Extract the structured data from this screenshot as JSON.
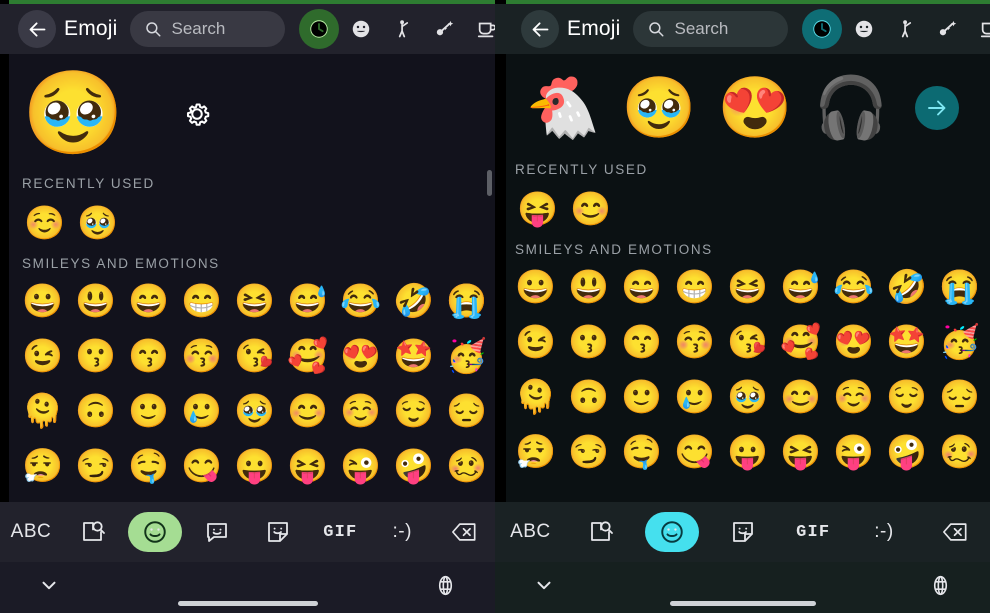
{
  "theme": {
    "left_accent": "#a5dd93",
    "right_accent": "#45e0ee",
    "left_bg": "#12121c",
    "right_bg": "#0b1113",
    "left_header_bg": "#22222c",
    "right_header_bg": "#1a2224",
    "left_active_cat": "#2f6b2c",
    "right_active_cat": "#0e6d75",
    "section_label_color": "#9aa0a6"
  },
  "left_panel": {
    "header": {
      "back_icon": "arrow-left-icon",
      "title": "Emoji",
      "search": {
        "icon": "search-icon",
        "placeholder": "Search",
        "value": ""
      },
      "categories": [
        {
          "name": "recent",
          "icon": "clock-icon",
          "active": true
        },
        {
          "name": "smileys",
          "icon": "smiley-icon",
          "active": false
        },
        {
          "name": "people",
          "icon": "person-icon",
          "active": false
        },
        {
          "name": "animals-nature",
          "icon": "leaf-flower-icon",
          "active": false
        },
        {
          "name": "food-drink",
          "icon": "cup-icon",
          "active": false
        }
      ]
    },
    "featured": {
      "emoji": "🥹",
      "settings_icon": "gear-icon"
    },
    "sections": [
      {
        "label": "RECENTLY USED",
        "emojis": [
          "☺️",
          "🥹"
        ]
      },
      {
        "label": "SMILEYS AND EMOTIONS",
        "rows": [
          [
            "😀",
            "😃",
            "😄",
            "😁",
            "😆",
            "😅",
            "😂",
            "🤣",
            "😭"
          ],
          [
            "😉",
            "😗",
            "😙",
            "😚",
            "😘",
            "🥰",
            "😍",
            "🤩",
            "🥳"
          ],
          [
            "🫠",
            "🙃",
            "🙂",
            "🥲",
            "🥹",
            "😊",
            "☺️",
            "😌",
            "😔"
          ],
          [
            "😮‍💨",
            "😏",
            "🤤",
            "😋",
            "😛",
            "😝",
            "😜",
            "🤪",
            "🥴"
          ]
        ]
      }
    ],
    "toolbar": [
      {
        "name": "abc-key",
        "label": "ABC",
        "type": "text",
        "active": false
      },
      {
        "name": "image-search-button",
        "label": "image-search-icon",
        "type": "icon",
        "active": false
      },
      {
        "name": "emoji-tab-button",
        "label": "smiley-icon",
        "type": "icon",
        "active": true
      },
      {
        "name": "emotion-sticker-button",
        "label": "speech-sticker-icon",
        "type": "icon",
        "active": false
      },
      {
        "name": "sticker-button",
        "label": "sticker-icon",
        "type": "icon",
        "active": false
      },
      {
        "name": "gif-button",
        "label": "GIF",
        "type": "text-gif",
        "active": false
      },
      {
        "name": "kaomoji-button",
        "label": ":-)",
        "type": "text-kao",
        "active": false
      },
      {
        "name": "backspace-button",
        "label": "backspace-icon",
        "type": "icon",
        "active": false
      }
    ],
    "navbar": {
      "back_icon": "chevron-down-icon",
      "language_icon": "globe-icon",
      "home_indicator": "home-indicator"
    }
  },
  "right_panel": {
    "header": {
      "back_icon": "arrow-left-icon",
      "title": "Emoji",
      "search": {
        "icon": "search-icon",
        "placeholder": "Search",
        "value": ""
      },
      "categories": [
        {
          "name": "recent",
          "icon": "clock-icon",
          "active": true
        },
        {
          "name": "smileys",
          "icon": "smiley-icon",
          "active": false
        },
        {
          "name": "people",
          "icon": "person-icon",
          "active": false
        },
        {
          "name": "animals-nature",
          "icon": "leaf-flower-icon",
          "active": false
        },
        {
          "name": "food-drink",
          "icon": "cup-icon",
          "active": false
        }
      ]
    },
    "featured": {
      "suggestions": [
        "🐔",
        "🥹",
        "😍",
        "🎧"
      ],
      "more_icon": "arrow-right-icon"
    },
    "sections": [
      {
        "label": "RECENTLY USED",
        "emojis": [
          "😝",
          "😊"
        ]
      },
      {
        "label": "SMILEYS AND EMOTIONS",
        "rows": [
          [
            "😀",
            "😃",
            "😄",
            "😁",
            "😆",
            "😅",
            "😂",
            "🤣",
            "😭"
          ],
          [
            "😉",
            "😗",
            "😙",
            "😚",
            "😘",
            "🥰",
            "😍",
            "🤩",
            "🥳"
          ],
          [
            "🫠",
            "🙃",
            "🙂",
            "🥲",
            "🥹",
            "😊",
            "☺️",
            "😌",
            "😔"
          ],
          [
            "😮‍💨",
            "😏",
            "🤤",
            "😋",
            "😛",
            "😝",
            "😜",
            "🤪",
            "🥴"
          ]
        ]
      }
    ],
    "toolbar": [
      {
        "name": "abc-key",
        "label": "ABC",
        "type": "text",
        "active": false
      },
      {
        "name": "image-search-button",
        "label": "image-search-icon",
        "type": "icon",
        "active": false
      },
      {
        "name": "emoji-tab-button",
        "label": "smiley-icon",
        "type": "icon",
        "active": true
      },
      {
        "name": "sticker-button",
        "label": "sticker-icon",
        "type": "icon",
        "active": false
      },
      {
        "name": "gif-button",
        "label": "GIF",
        "type": "text-gif",
        "active": false
      },
      {
        "name": "kaomoji-button",
        "label": ":-)",
        "type": "text-kao",
        "active": false
      },
      {
        "name": "backspace-button",
        "label": "backspace-icon",
        "type": "icon",
        "active": false
      }
    ],
    "navbar": {
      "back_icon": "chevron-down-icon",
      "language_icon": "globe-icon",
      "home_indicator": "home-indicator"
    }
  }
}
